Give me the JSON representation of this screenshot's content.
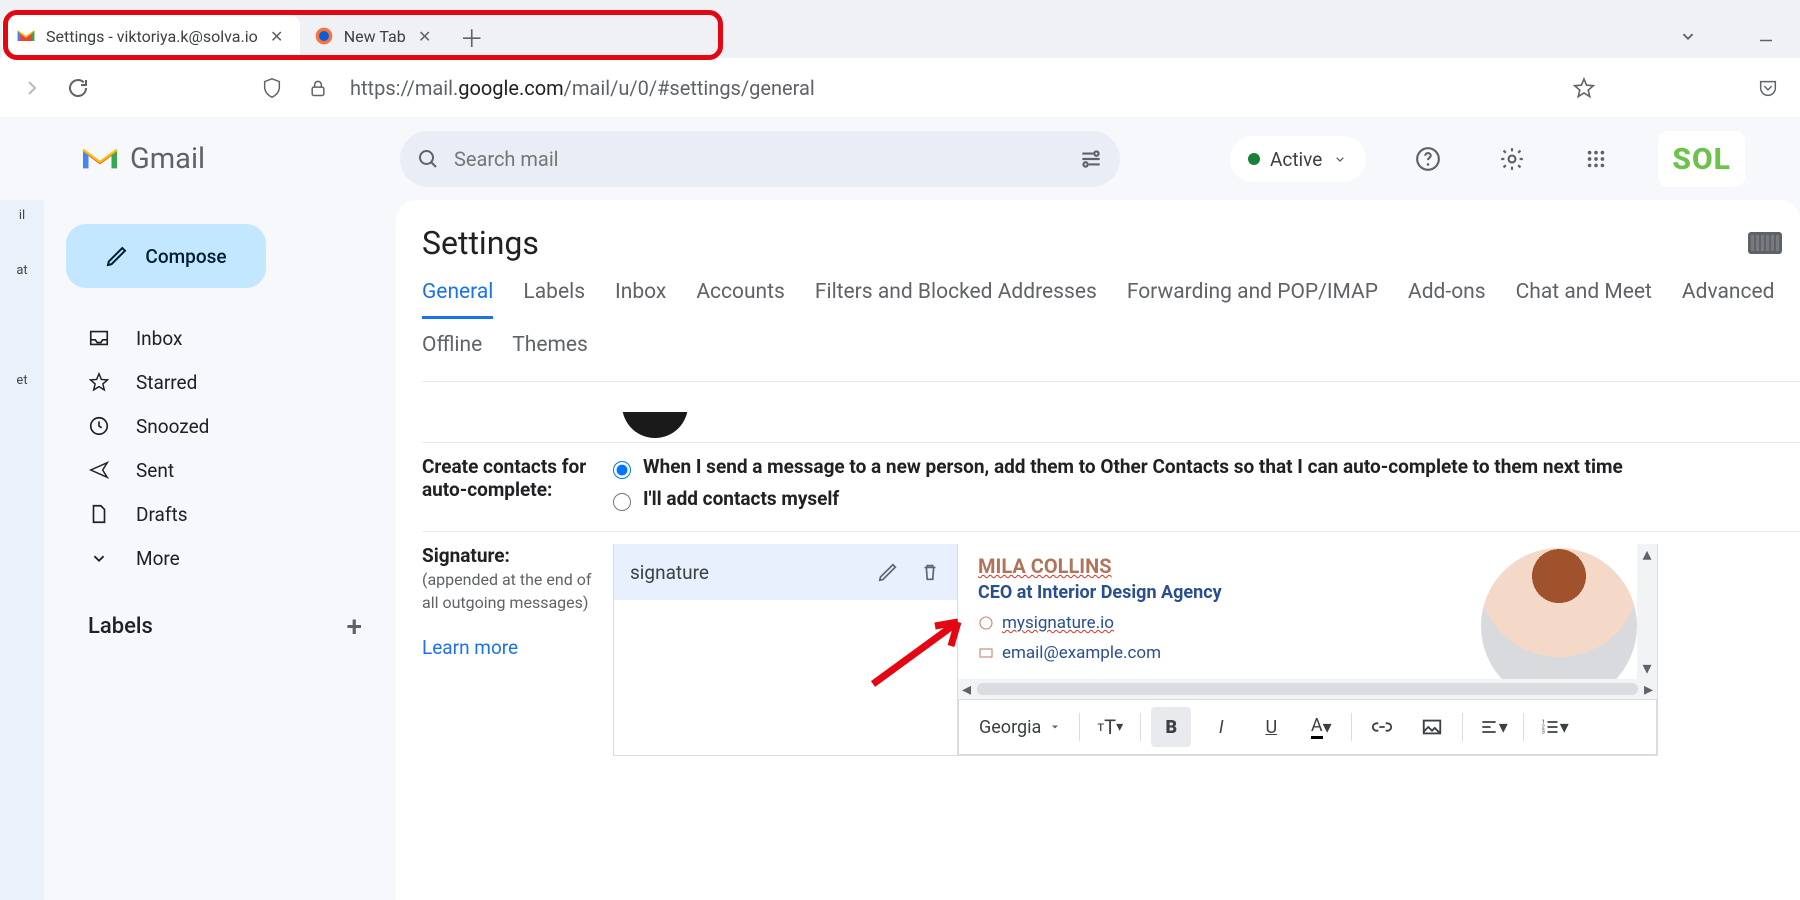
{
  "browser": {
    "tabs": [
      {
        "label": "Settings - viktoriya.k@solva.io"
      },
      {
        "label": "New Tab"
      }
    ],
    "url_prefix": "https://mail.",
    "url_host": "google.com",
    "url_path": "/mail/u/0/#settings/general"
  },
  "header": {
    "product": "Gmail",
    "search_placeholder": "Search mail",
    "status_label": "Active",
    "org_badge": "SOL"
  },
  "compose_label": "Compose",
  "nav": {
    "inbox": "Inbox",
    "starred": "Starred",
    "snoozed": "Snoozed",
    "sent": "Sent",
    "drafts": "Drafts",
    "more": "More"
  },
  "labels_heading": "Labels",
  "rail": {
    "mail": "il",
    "chat": "at",
    "meet": "et"
  },
  "settings_title": "Settings",
  "tabs": {
    "general": "General",
    "labels": "Labels",
    "inbox": "Inbox",
    "accounts": "Accounts",
    "filters": "Filters and Blocked Addresses",
    "forwarding": "Forwarding and POP/IMAP",
    "addons": "Add-ons",
    "chat": "Chat and Meet",
    "advanced": "Advanced",
    "offline": "Offline",
    "themes": "Themes"
  },
  "contacts": {
    "row_label": "Create contacts for auto-complete:",
    "opt1": "When I send a message to a new person, add them to Other Contacts so that I can auto-complete to them next time",
    "opt2": "I'll add contacts myself"
  },
  "signature": {
    "row_label": "Signature:",
    "row_sub": "(appended at the end of all outgoing messages)",
    "learn_more": "Learn more",
    "list_item": "signature",
    "preview": {
      "name": "MILA COLLINS",
      "role": "CEO at Interior Design Agency",
      "site": "mysignature.io",
      "email": "email@example.com"
    },
    "toolbar": {
      "font": "Georgia"
    }
  }
}
